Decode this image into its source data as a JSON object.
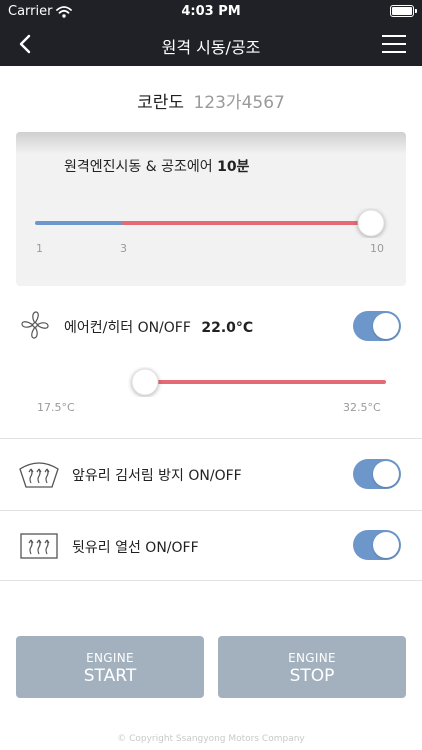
{
  "status_bar": {
    "carrier": "Carrier",
    "time": "4:03 PM"
  },
  "header": {
    "title": "원격 시동/공조"
  },
  "vehicle": {
    "name": "코란도",
    "plate": "123가4567"
  },
  "engine_timer": {
    "label": "원격엔진시동 & 공조에어",
    "value": "10분",
    "ticks": [
      "1",
      "3",
      "10"
    ],
    "selected_minutes": 10,
    "min_minutes": 1,
    "max_minutes": 10
  },
  "aircon": {
    "label": "에어컨/히터 ON/OFF",
    "temperature": "22.0°C",
    "min_label": "17.5°C",
    "max_label": "32.5°C",
    "min_temp": 17.5,
    "max_temp": 32.5,
    "current_temp": 22.0,
    "enabled": true
  },
  "front_defrost": {
    "label": "앞유리 김서림 방지 ON/OFF",
    "enabled": true
  },
  "rear_heater": {
    "label": "뒷유리 열선 ON/OFF",
    "enabled": true
  },
  "buttons": {
    "start": {
      "line1": "ENGINE",
      "line2": "START"
    },
    "stop": {
      "line1": "ENGINE",
      "line2": "STOP"
    }
  },
  "footer": {
    "copyright": "© Copyright Ssangyong Motors Company"
  },
  "colors": {
    "header_bg": "#1f2126",
    "slider_blue": "#6d97cb",
    "slider_red": "#e46b73",
    "toggle_on": "#6d97cb",
    "button_bg": "#a3b1bf"
  },
  "icons": {
    "back": "chevron-left-icon",
    "menu": "hamburger-menu-icon",
    "fan": "fan-icon",
    "front_defrost": "front-defrost-icon",
    "rear_defrost": "rear-defrost-icon",
    "wifi": "wifi-icon",
    "battery": "battery-icon"
  }
}
